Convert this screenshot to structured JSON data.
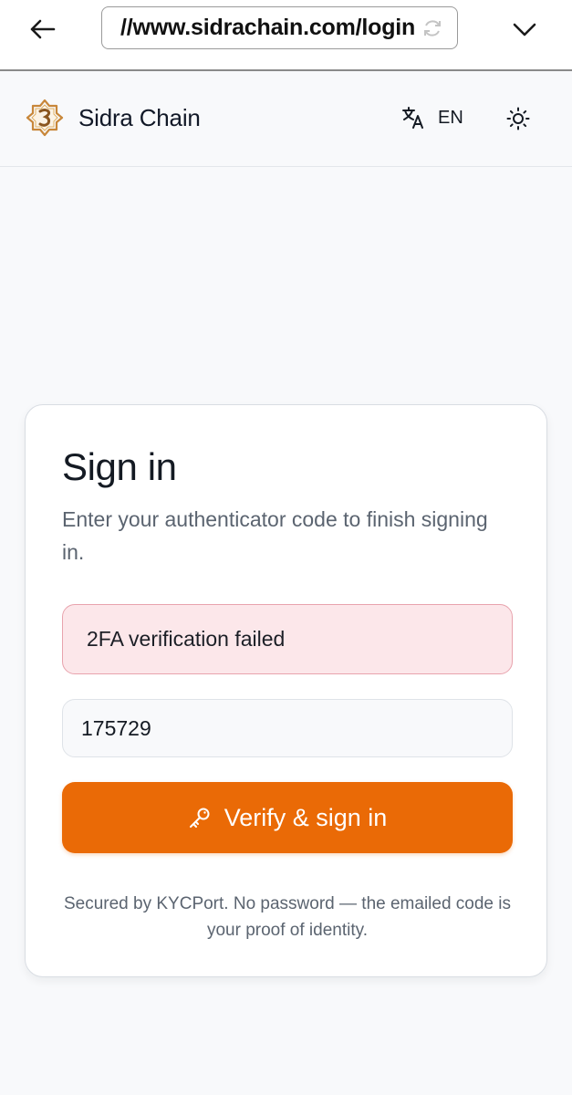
{
  "browser": {
    "url": "//www.sidrachain.com/login",
    "icons": {
      "back": "arrow-left-icon",
      "reload": "reload-icon",
      "menu": "chevron-down-icon"
    }
  },
  "header": {
    "brand_name": "Sidra Chain",
    "language": "EN",
    "icons": {
      "logo": "sidra-logo",
      "translate": "translate-icon",
      "theme": "sun-icon"
    }
  },
  "signin": {
    "title": "Sign in",
    "subtitle": "Enter your authenticator code to finish signing in.",
    "error": "2FA verification failed",
    "code_value": "175729",
    "button_label": "Verify & sign in",
    "button_icon": "key-icon",
    "footer": "Secured by KYCPort. No password — the emailed code is your proof of identity."
  },
  "colors": {
    "accent": "#ea6a06",
    "error_bg": "#fce7ea",
    "error_border": "#e8a3ad",
    "page_bg": "#f8f9fb",
    "logo_gold": "#c8873a"
  }
}
